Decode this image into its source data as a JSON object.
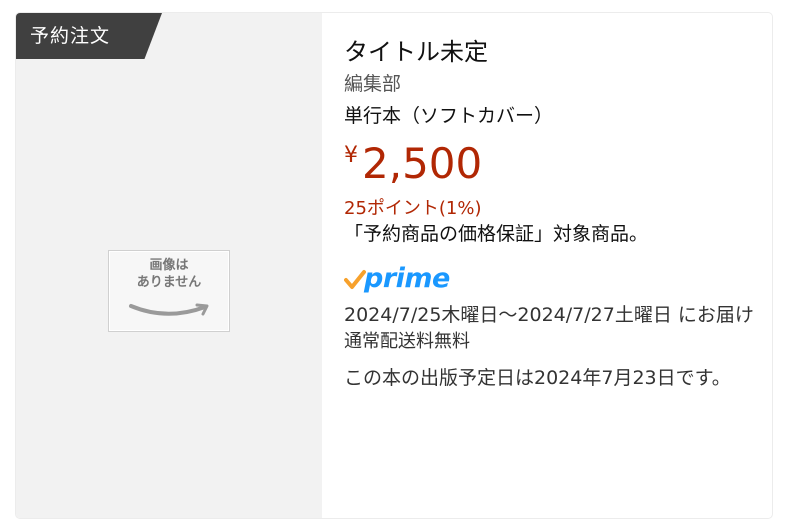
{
  "badge": {
    "label": "予約注文"
  },
  "placeholder_image": {
    "line1": "画像は",
    "line2": "ありません"
  },
  "product": {
    "title": "タイトル未定",
    "author": "編集部",
    "format": "単行本（ソフトカバー）",
    "price_symbol": "¥",
    "price_amount": "2,500",
    "points": "25ポイント(1%)",
    "price_guarantee": "「予約商品の価格保証」対象商品。",
    "prime_label": "prime",
    "delivery": "2024/7/25木曜日～2024/7/27土曜日 にお届け",
    "shipping": "通常配送料無料",
    "release_note": "この本の出版予定日は2024年7月23日です。"
  },
  "colors": {
    "price": "#b12704",
    "prime_blue": "#1a98ff",
    "prime_check": "#f7a12c",
    "badge_bg": "#404040"
  }
}
